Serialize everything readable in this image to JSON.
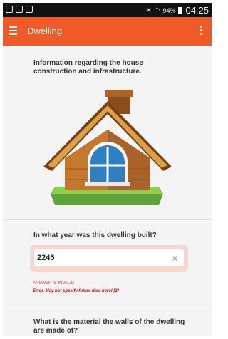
{
  "status_bar": {
    "battery": "94%",
    "time": "04:25"
  },
  "app_bar": {
    "title": "Dwelling"
  },
  "intro_text": "Information regarding the house construction and infrastructure.",
  "question_year": {
    "label": "In what year was this dwelling built?",
    "value": "2245",
    "clear_icon": "×",
    "validation_status": "ANSWER IS INVALID",
    "error_message": "Error. May not specify future date here! [2]"
  },
  "question_walls": {
    "label": "What is the material the walls of the dwelling are made of?"
  },
  "colors": {
    "app_bar": "#f05a28",
    "error": "#d00000",
    "invalid_field_bg": "#f4d7d2"
  },
  "icons": [
    "hamburger-menu-icon",
    "more-vert-icon",
    "clear-icon",
    "house-illustration"
  ]
}
